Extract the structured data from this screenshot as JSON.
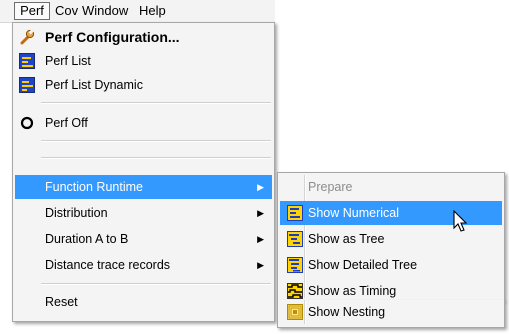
{
  "menubar": {
    "items": [
      "Perf",
      "Cov",
      "Window",
      "Help"
    ]
  },
  "perf_menu": {
    "items": [
      {
        "label": "Perf Configuration...",
        "icon": "wrench-icon"
      },
      {
        "label": "Perf List",
        "icon": "list-chart-icon"
      },
      {
        "label": "Perf List Dynamic",
        "icon": "list-chart-dynamic-icon"
      },
      {
        "label": "Perf Off",
        "icon": "circle-off-icon"
      },
      {
        "label": "Function Runtime",
        "submenu": true
      },
      {
        "label": "Distribution",
        "submenu": true
      },
      {
        "label": "Duration A to B",
        "submenu": true
      },
      {
        "label": "Distance trace records",
        "submenu": true
      },
      {
        "label": "Reset"
      }
    ]
  },
  "function_runtime_submenu": {
    "items": [
      {
        "label": "Prepare",
        "enabled": false
      },
      {
        "label": "Show Numerical",
        "icon": "numerical-icon"
      },
      {
        "label": "Show as Tree",
        "icon": "tree-icon"
      },
      {
        "label": "Show Detailed Tree",
        "icon": "detailed-tree-icon"
      },
      {
        "label": "Show as Timing",
        "icon": "timing-icon"
      },
      {
        "label": "Show Nesting",
        "icon": "nesting-icon"
      }
    ]
  },
  "colors": {
    "highlight": "#3399ff",
    "menu_background": "#f4f4f4",
    "disabled_text": "#8d8d8d"
  }
}
